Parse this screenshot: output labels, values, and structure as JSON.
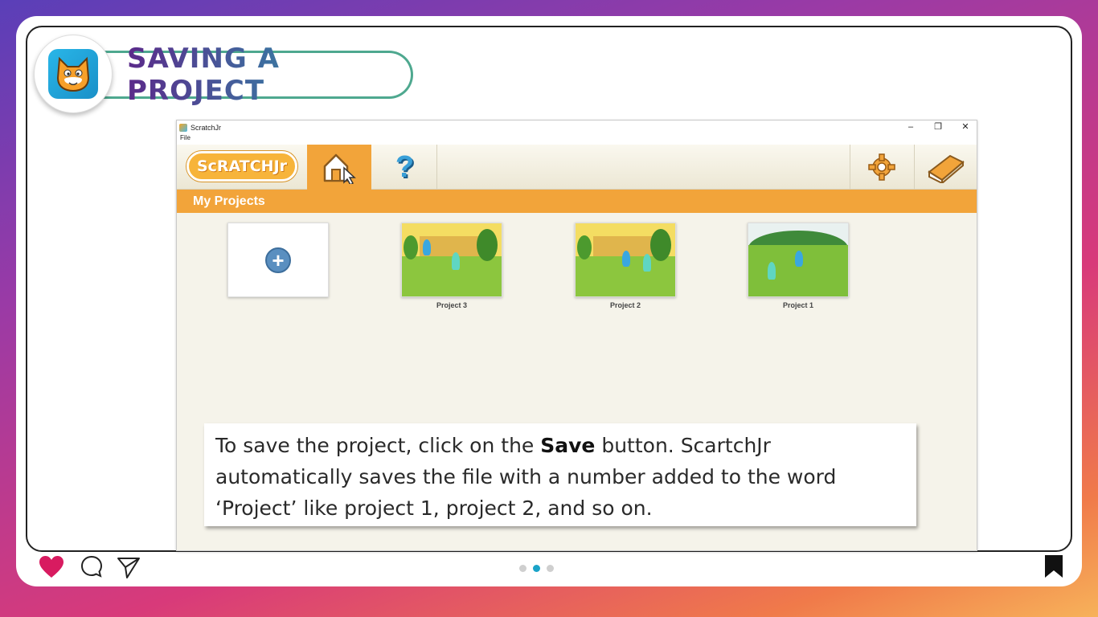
{
  "header": {
    "title": "SAVING A PROJECT",
    "logo_icon": "scratch-cat-icon"
  },
  "window": {
    "title": "ScratchJr",
    "menu_file": "File",
    "controls": {
      "minimize": "–",
      "restore": "❐",
      "close": "✕"
    }
  },
  "toolbar": {
    "logo_text": "ScRATCHJr",
    "home_icon": "home-icon",
    "help_icon": "help-icon",
    "help_glyph": "?",
    "settings_icon": "gear-icon",
    "book_icon": "book-icon"
  },
  "section": {
    "title": "My Projects"
  },
  "projects": [
    {
      "label": "",
      "type": "new"
    },
    {
      "label": "Project 3",
      "type": "city"
    },
    {
      "label": "Project 2",
      "type": "city"
    },
    {
      "label": "Project 1",
      "type": "field"
    }
  ],
  "new_project_glyph": "+",
  "caption": {
    "part1": "To save the project, click on the ",
    "bold": "Save",
    "part2": " button. ScartchJr automatically saves the file with a number added to the word ‘Project’ like project 1, project 2, and so on."
  },
  "footer": {
    "icons": [
      "heart-icon",
      "comment-icon",
      "send-icon",
      "bookmark-icon"
    ],
    "pagination": {
      "total": 3,
      "active": 2
    },
    "colors": {
      "heart": "#d81b60",
      "active_dot": "#1aa3c8"
    }
  },
  "colors": {
    "accent": "#f2a43a",
    "title_border": "#4ea88f"
  }
}
